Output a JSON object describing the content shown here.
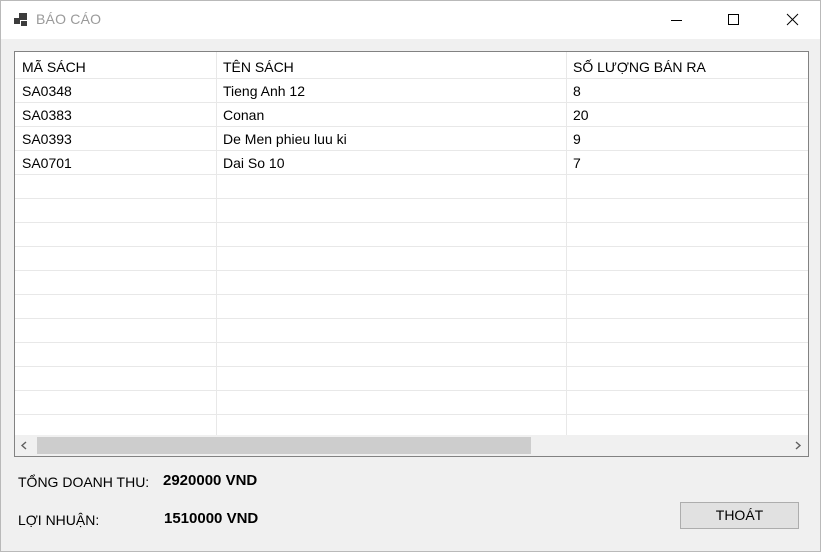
{
  "window": {
    "title": "BÁO CÁO"
  },
  "table": {
    "columns": [
      "MÃ SÁCH",
      "TÊN SÁCH",
      "SỐ LƯỢNG BÁN RA"
    ],
    "rows": [
      [
        "SA0348",
        "Tieng Anh 12",
        "8"
      ],
      [
        "SA0383",
        "Conan",
        "20"
      ],
      [
        "SA0393",
        "De Men phieu luu ki",
        "9"
      ],
      [
        "SA0701",
        "Dai So 10",
        "7"
      ]
    ]
  },
  "summary": {
    "revenue_label": "TỔNG DOANH THU:",
    "revenue_value": "2920000 VND",
    "profit_label": "LỢI NHUẬN:",
    "profit_value": "1510000 VND"
  },
  "buttons": {
    "exit_label": "THOÁT"
  }
}
